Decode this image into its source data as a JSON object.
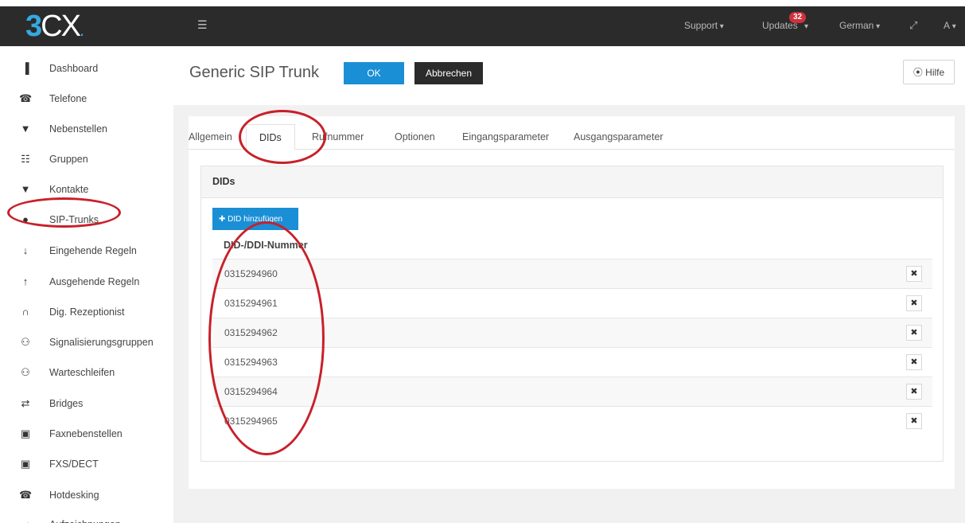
{
  "topbar": {
    "logo_mark": "3",
    "logo_text": "CX",
    "menu_icon": "menu-icon",
    "support": "Support",
    "updates": "Updates",
    "updates_badge": "32",
    "language": "German",
    "expand_icon": "expand-icon",
    "user": "A"
  },
  "sidebar": {
    "items": [
      {
        "icon": "dashboard-icon",
        "glyph": "▐",
        "label": "Dashboard"
      },
      {
        "icon": "phone-icon",
        "glyph": "☎",
        "label": "Telefone"
      },
      {
        "icon": "user-icon",
        "glyph": "▼",
        "label": "Nebenstellen"
      },
      {
        "icon": "grid-icon",
        "glyph": "☷",
        "label": "Gruppen"
      },
      {
        "icon": "contact-icon",
        "glyph": "▼",
        "label": "Kontakte"
      },
      {
        "icon": "globe-icon",
        "glyph": "●",
        "label": "SIP-Trunks"
      },
      {
        "icon": "arrow-down-icon",
        "glyph": "↓",
        "label": "Eingehende Regeln"
      },
      {
        "icon": "arrow-up-icon",
        "glyph": "↑",
        "label": "Ausgehende Regeln"
      },
      {
        "icon": "headset-icon",
        "glyph": "∩",
        "label": "Dig. Rezeptionist"
      },
      {
        "icon": "users-icon",
        "glyph": "⚇",
        "label": "Signalisierungsgruppen"
      },
      {
        "icon": "queue-icon",
        "glyph": "⚇",
        "label": "Warteschleifen"
      },
      {
        "icon": "bridge-icon",
        "glyph": "⇄",
        "label": "Bridges"
      },
      {
        "icon": "fax-icon",
        "glyph": "▣",
        "label": "Faxnebenstellen"
      },
      {
        "icon": "fxs-icon",
        "glyph": "▣",
        "label": "FXS/DECT"
      },
      {
        "icon": "hotdesk-icon",
        "glyph": "☎",
        "label": "Hotdesking"
      },
      {
        "icon": "recording-icon",
        "glyph": "◂",
        "label": "Aufzeichnungen"
      }
    ]
  },
  "header": {
    "title": "Generic SIP Trunk",
    "ok": "OK",
    "cancel": "Abbrechen",
    "help": "⦿ Hilfe"
  },
  "tabs": [
    {
      "label": "Allgemein"
    },
    {
      "label": "DIDs"
    },
    {
      "label": "Rufnummer"
    },
    {
      "label": "Optionen"
    },
    {
      "label": "Eingangsparameter"
    },
    {
      "label": "Ausgangsparameter"
    }
  ],
  "dids": {
    "title": "DIDs",
    "add_button": "✚ DID hinzufügen",
    "column": "DID-/DDI-Nummer",
    "rows": [
      "0315294960",
      "0315294961",
      "0315294962",
      "0315294963",
      "0315294964",
      "0315294965"
    ],
    "delete_glyph": "✖"
  },
  "colors": {
    "accent": "#1a8fd6",
    "topbar": "#2b2b2b",
    "annotation": "#c8202a"
  }
}
